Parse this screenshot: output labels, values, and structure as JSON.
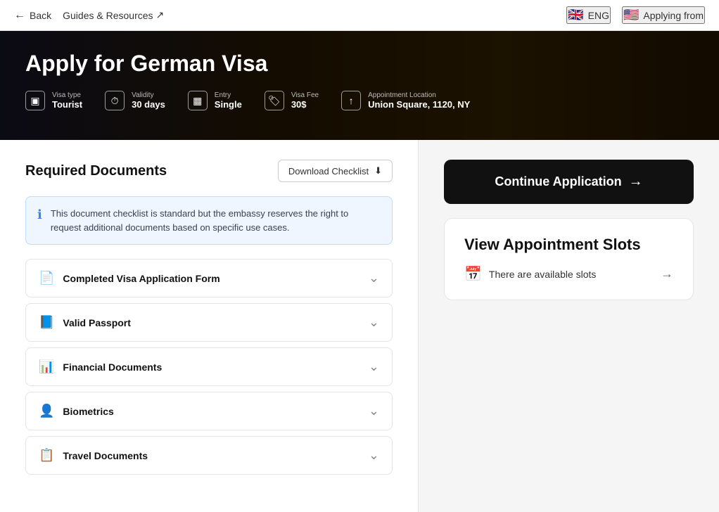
{
  "nav": {
    "back_label": "Back",
    "guides_label": "Guides & Resources",
    "external_icon": "↗",
    "lang": "ENG",
    "applying_from": "Applying from"
  },
  "hero": {
    "title": "Apply for German Visa",
    "meta": [
      {
        "id": "visa-type",
        "label": "Visa type",
        "value": "Tourist",
        "icon": "▣"
      },
      {
        "id": "validity",
        "label": "Validity",
        "value": "30 days",
        "icon": "⏱"
      },
      {
        "id": "entry",
        "label": "Entry",
        "value": "Single",
        "icon": "▦"
      },
      {
        "id": "visa-fee",
        "label": "Visa Fee",
        "value": "30$",
        "icon": "🏷"
      },
      {
        "id": "appointment-location",
        "label": "Appointment Location",
        "value": "Union Square, 1120, NY",
        "icon": "↑"
      }
    ]
  },
  "left": {
    "section_title": "Required Documents",
    "download_btn": "Download Checklist",
    "info_text": "This document checklist is standard but the embassy reserves the right to request additional documents based on specific use cases.",
    "documents": [
      {
        "id": "completed-visa-form",
        "name": "Completed Visa Application Form",
        "icon": "📄"
      },
      {
        "id": "valid-passport",
        "name": "Valid Passport",
        "icon": "📘"
      },
      {
        "id": "financial-documents",
        "name": "Financial Documents",
        "icon": "📊"
      },
      {
        "id": "biometrics",
        "name": "Biometrics",
        "icon": "👤"
      },
      {
        "id": "travel-documents",
        "name": "Travel Documents",
        "icon": "📋"
      }
    ]
  },
  "right": {
    "continue_btn": "Continue Application",
    "appointment_title": "View Appointment Slots",
    "slots_available": "There are available slots"
  }
}
